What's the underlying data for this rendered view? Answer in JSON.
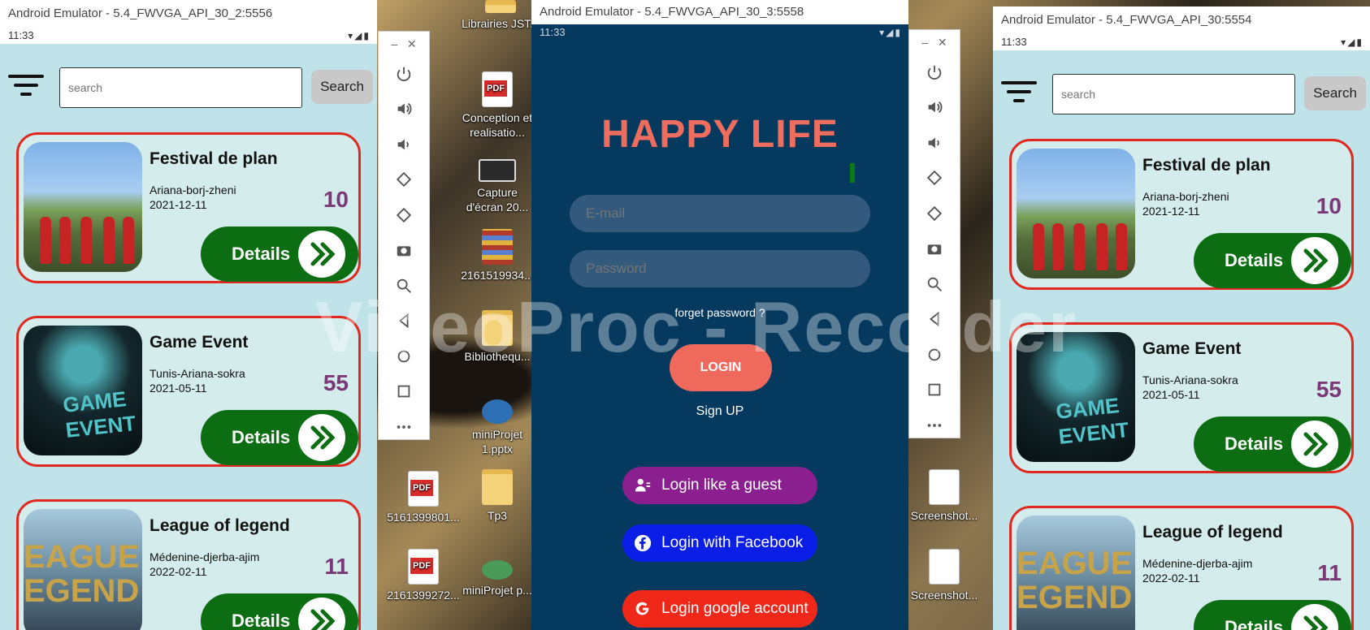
{
  "left_window": {
    "title": "Android Emulator - 5.4_FWVGA_API_30_2:5556",
    "status_time": "11:33",
    "search_placeholder": "search",
    "search_button": "Search",
    "cards": [
      {
        "title": "Festival de plan",
        "location": "Ariana-borj-zheni",
        "date": "2021-12-11",
        "count": "10",
        "button": "Details",
        "image": "festival-image"
      },
      {
        "title": "Game Event",
        "location": "Tunis-Ariana-sokra",
        "date": "2021-05-11",
        "count": "55",
        "button": "Details",
        "image": "game-event-image"
      },
      {
        "title": "League of legend",
        "location": "Médenine-djerba-ajim",
        "date": "2022-02-11",
        "count": "11",
        "button": "Details",
        "image": "league-image"
      }
    ]
  },
  "center_window": {
    "title": "Android Emulator - 5.4_FWVGA_API_30_3:5558",
    "status_time": "11:33",
    "app_title": "HAPPY LIFE",
    "email_placeholder": "E-mail",
    "password_placeholder": "Password",
    "forget_password": "forget password ?",
    "login_button": "LOGIN",
    "signup": "Sign UP",
    "guest_button": "Login like a guest",
    "facebook_button": "Login with Facebook",
    "google_button": "Login google account"
  },
  "right_window": {
    "title": "Android Emulator - 5.4_FWVGA_API_30:5554",
    "status_time": "11:33",
    "search_placeholder": "search",
    "search_button": "Search",
    "cards": [
      {
        "title": "Festival de plan",
        "location": "Ariana-borj-zheni",
        "date": "2021-12-11",
        "count": "10",
        "button": "Details"
      },
      {
        "title": "Game Event",
        "location": "Tunis-Ariana-sokra",
        "date": "2021-05-11",
        "count": "55",
        "button": "Details"
      },
      {
        "title": "League of legend",
        "location": "Médenine-djerba-ajim",
        "date": "2022-02-11",
        "count": "11",
        "button": "Details"
      }
    ]
  },
  "desktop_icons": [
    "Librairies JST...",
    "Conception et realisatio...",
    "Capture d'écran 20...",
    "2161519934...",
    "Bibliothequ...",
    "miniProjet 1.pptx",
    "Tp3",
    "5161399801...",
    "2161399272...",
    "miniProjet p...",
    "Screenshot...",
    "Screenshot..."
  ],
  "watermark": "VideoProc - Recorder",
  "colors": {
    "card_border": "#e0281e",
    "details_green": "#0c6d12",
    "count_purple": "#7b3877",
    "login_bg": "#06395e",
    "happy_red": "#ee6d5f",
    "guest_purple": "#8b1f8f",
    "facebook_blue": "#0a1ee8",
    "google_red": "#f0281a"
  }
}
